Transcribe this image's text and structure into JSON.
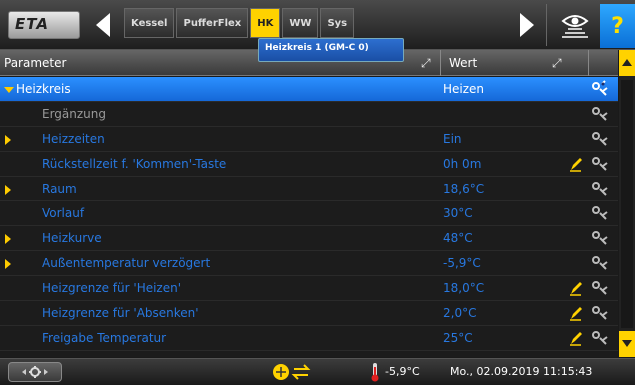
{
  "toolbar": {
    "logo_text": "ETA",
    "tabs": [
      {
        "label": "Kessel"
      },
      {
        "label": "PufferFlex"
      },
      {
        "label": "HK"
      },
      {
        "label": "WW"
      },
      {
        "label": "Sys"
      }
    ],
    "active_tab": "HK",
    "tooltip": "Heizkreis 1 (GM-C 0)",
    "help_label": "?"
  },
  "table": {
    "col_parameter": "Parameter",
    "col_wert": "Wert",
    "rows": [
      {
        "name": "Heizkreis",
        "value": "Heizen"
      },
      {
        "name": "Ergänzung",
        "value": ""
      },
      {
        "name": "Heizzeiten",
        "value": "Ein"
      },
      {
        "name": "Rückstellzeit f. 'Kommen'-Taste",
        "value": "0h 0m"
      },
      {
        "name": "Raum",
        "value": "18,6°C"
      },
      {
        "name": "Vorlauf",
        "value": "30°C"
      },
      {
        "name": "Heizkurve",
        "value": "48°C"
      },
      {
        "name": "Außentemperatur verzögert",
        "value": "-5,9°C"
      },
      {
        "name": "Heizgrenze für 'Heizen'",
        "value": "18,0°C"
      },
      {
        "name": "Heizgrenze für 'Absenken'",
        "value": "2,0°C"
      },
      {
        "name": "Freigabe Temperatur",
        "value": "25°C"
      }
    ]
  },
  "status": {
    "outdoor_temp": "-5,9°C",
    "datetime": "Mo., 02.09.2019 11:15:43"
  },
  "colors": {
    "accent": "#ffd200",
    "link_blue": "#2878e0",
    "selected": "#1e7cf0"
  }
}
